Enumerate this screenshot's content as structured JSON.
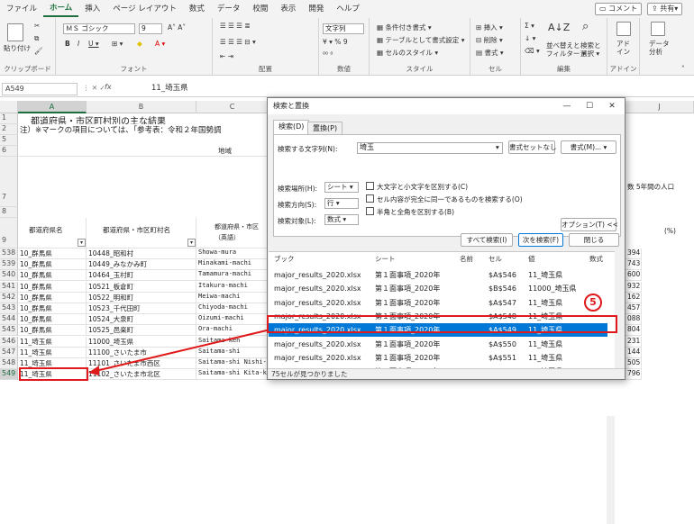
{
  "tabs": [
    "ファイル",
    "ホーム",
    "挿入",
    "ページ レイアウト",
    "数式",
    "データ",
    "校閲",
    "表示",
    "開発",
    "ヘルプ"
  ],
  "topright": {
    "comment": "コメント",
    "share": "共有"
  },
  "ribbon": {
    "groups": {
      "clipboard": "クリップボード",
      "font": "フォント",
      "alignment": "配置",
      "number": "数値",
      "styles": "スタイル",
      "cells": "セル",
      "editing": "編集",
      "addins": "アドイン"
    },
    "paste": "貼り付け",
    "font_name": "ＭＳ ゴシック",
    "font_size": "9",
    "number_format": "文字列",
    "style_items": [
      "条件付き書式",
      "テーブルとして書式設定",
      "セルのスタイル"
    ],
    "cell_items": [
      "挿入",
      "削除",
      "書式"
    ],
    "edit_items": [
      "並べ替えと\nフィルター",
      "検索と\n選択"
    ],
    "addin_label": "アド\nイン",
    "data_analysis": "データ\n分析"
  },
  "formula_bar": {
    "name_box": "A549",
    "fx": "fx",
    "value": "11_埼玉県"
  },
  "sheet": {
    "columns": [
      "A",
      "B",
      "C",
      "J"
    ],
    "title": "都道府県・市区町村別の主な結果",
    "note": "注）※マークの項目については、「参考表：令和２年国勢調",
    "region": "地域",
    "col_a_header": "都道府県名",
    "col_b_header": "都道府県・市区町村名",
    "col_c_header": "都道府県・市区\n（英語）",
    "right_header": "5年間の人口",
    "pct": "(%)",
    "rows": [
      {
        "n": "538",
        "a": "10_群馬県",
        "b": "10448_昭和村",
        "c": "Showa-mura",
        "r": "394"
      },
      {
        "n": "539",
        "a": "10_群馬県",
        "b": "10449_みなかみ町",
        "c": "Minakami-machi",
        "r": "743"
      },
      {
        "n": "540",
        "a": "10_群馬県",
        "b": "10464_玉村町",
        "c": "Tamamura-machi",
        "r": "600"
      },
      {
        "n": "541",
        "a": "10_群馬県",
        "b": "10521_板倉町",
        "c": "Itakura-machi",
        "r": "932"
      },
      {
        "n": "542",
        "a": "10_群馬県",
        "b": "10522_明和町",
        "c": "Meiwa-machi",
        "r": "162"
      },
      {
        "n": "543",
        "a": "10_群馬県",
        "b": "10523_千代田町",
        "c": "Chiyoda-machi",
        "r": "457"
      },
      {
        "n": "544",
        "a": "10_群馬県",
        "b": "10524_大泉町",
        "c": "Oizumi-machi",
        "r": "088"
      },
      {
        "n": "545",
        "a": "10_群馬県",
        "b": "10525_邑楽町",
        "c": "Ora-machi",
        "r": "804"
      },
      {
        "n": "546",
        "a": "11_埼玉県",
        "b": "11000_埼玉県",
        "c": "Saitama-ken",
        "r": "231"
      },
      {
        "n": "547",
        "a": "11_埼玉県",
        "b": "11100_さいたま市",
        "c": "Saitama-shi",
        "r": "144"
      },
      {
        "n": "548",
        "a": "11_埼玉県",
        "b": "11101_さいたま市西区",
        "c": "Saitama-shi Nishi-ku",
        "r": "505"
      },
      {
        "n": "549",
        "a": "11_埼玉県",
        "b": "11102_さいたま市北区",
        "c": "Saitama-shi Kita-ku",
        "r": "796"
      }
    ],
    "row_nums_top": [
      "1",
      "2",
      "5",
      "6",
      "7",
      "8",
      "9"
    ],
    "right_col_top": "数"
  },
  "dialog": {
    "title": "検索と置換",
    "win_min": "—",
    "win_max": "☐",
    "win_close": "✕",
    "tab_find": "検索(D)",
    "tab_replace": "置換(P)",
    "find_label": "検索する文字列(N):",
    "find_value": "埼玉",
    "format_unset": "書式セットなし",
    "format_btn": "書式(M)...",
    "scope_label": "検索場所(H):",
    "scope_value": "シート",
    "direction_label": "検索方向(S):",
    "direction_value": "行",
    "target_label": "検索対象(L):",
    "target_value": "数式",
    "options": [
      "大文字と小文字を区別する(C)",
      "セル内容が完全に同一であるものを検索する(O)",
      "半角と全角を区別する(B)"
    ],
    "options_btn": "オプション(T) <<",
    "find_all": "すべて検索(I)",
    "find_next": "次を検索(F)",
    "close": "閉じる",
    "result_headers": [
      "ブック",
      "シート",
      "名前",
      "セル",
      "値",
      "数式"
    ],
    "results": [
      {
        "book": "major_results_2020.xlsx",
        "sheet": "第１面事項_2020年",
        "cell": "$A$546",
        "value": "11_埼玉県"
      },
      {
        "book": "major_results_2020.xlsx",
        "sheet": "第１面事項_2020年",
        "cell": "$B$546",
        "value": "11000_埼玉県"
      },
      {
        "book": "major_results_2020.xlsx",
        "sheet": "第１面事項_2020年",
        "cell": "$A$547",
        "value": "11_埼玉県"
      },
      {
        "book": "major_results_2020.xlsx",
        "sheet": "第１面事項_2020年",
        "cell": "$A$548",
        "value": "11_埼玉県"
      },
      {
        "book": "major_results_2020.xlsx",
        "sheet": "第１面事項_2020年",
        "cell": "$A$549",
        "value": "11_埼玉県"
      },
      {
        "book": "major_results_2020.xlsx",
        "sheet": "第１面事項_2020年",
        "cell": "$A$550",
        "value": "11_埼玉県"
      },
      {
        "book": "major_results_2020.xlsx",
        "sheet": "第１面事項_2020年",
        "cell": "$A$551",
        "value": "11_埼玉県"
      },
      {
        "book": "major_results_2020.xlsx",
        "sheet": "第１面事項_2020年",
        "cell": "$A$552",
        "value": "11_埼玉県"
      }
    ],
    "status": "75セルが見つかりました"
  },
  "callout": "5",
  "colors": {
    "accent": "#1e6f3f",
    "highlight": "#0078d7",
    "annotation": "#e01a1a"
  }
}
